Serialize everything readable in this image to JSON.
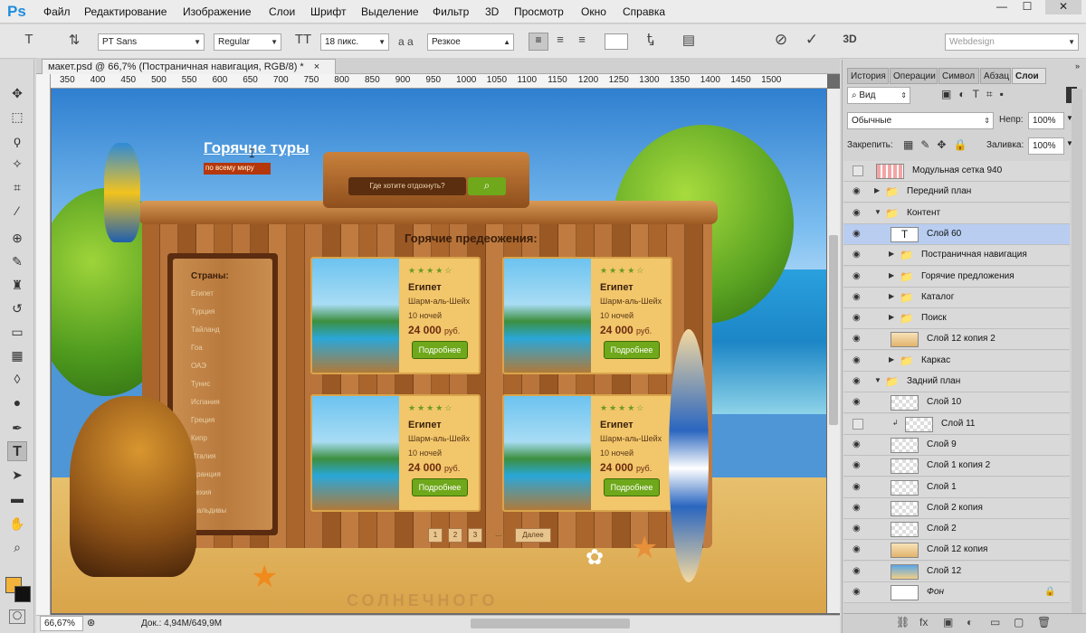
{
  "app": {
    "logo": "Ps"
  },
  "menu": [
    "Файл",
    "Редактирование",
    "Изображение",
    "Слои",
    "Шрифт",
    "Выделение",
    "Фильтр",
    "3D",
    "Просмотр",
    "Окно",
    "Справка"
  ],
  "window_controls": {
    "minimize": "—",
    "maximize": "☐",
    "close": "✕"
  },
  "options": {
    "font_family": "PT Sans",
    "font_style": "Regular",
    "font_size": "18 пикс.",
    "antialias_label": "a a",
    "antialias": "Резкое",
    "workspace": "Webdesign"
  },
  "document": {
    "tab_title": "макет.psd @ 66,7% (Постраничная навигация, RGB/8) *",
    "tab_close": "×",
    "ruler_ticks": [
      "350",
      "400",
      "450",
      "500",
      "550",
      "600",
      "650",
      "700",
      "750",
      "800",
      "850",
      "900",
      "950",
      "1000",
      "1050",
      "1100",
      "1150",
      "1200",
      "1250",
      "1300",
      "1350",
      "1400",
      "1450",
      "1500"
    ]
  },
  "canvas": {
    "headline": "Горячие туры",
    "subtitle": "по всему миру",
    "search_placeholder": "Где хотите отдохнуть?",
    "offers_title": "Горячие предеожения:",
    "countries_title": "Страны:",
    "countries": [
      "Египет",
      "Турция",
      "Тайланд",
      "Гоа",
      "ОАЭ",
      "Тунис",
      "Испания",
      "Греция",
      "Кипр",
      "Италия",
      "Франция",
      "Чехия",
      "Мальдивы"
    ],
    "cards": [
      {
        "stars": "★★★★☆",
        "title": "Египет",
        "place": "Шарм-аль-Шейх",
        "nights": "10 ночей",
        "price": "24 000",
        "currency": "руб.",
        "button": "Подробнее"
      },
      {
        "stars": "★★★★☆",
        "title": "Египет",
        "place": "Шарм-аль-Шейх",
        "nights": "10 ночей",
        "price": "24 000",
        "currency": "руб.",
        "button": "Подробнее"
      },
      {
        "stars": "★★★★☆",
        "title": "Египет",
        "place": "Шарм-аль-Шейх",
        "nights": "10 ночей",
        "price": "24 000",
        "currency": "руб.",
        "button": "Подробнее"
      },
      {
        "stars": "★★★★☆",
        "title": "Египет",
        "place": "Шарм-аль-Шейх",
        "nights": "10 ночей",
        "price": "24 000",
        "currency": "руб.",
        "button": "Подробнее"
      }
    ],
    "pages": [
      "1",
      "2",
      "3"
    ],
    "ellipsis": "...",
    "next": "Далее",
    "sand_text": "СОЛНЕЧНОГО"
  },
  "status": {
    "zoom": "66,67%",
    "doc": "Док.: 4,94M/649,9M"
  },
  "panel": {
    "tabs": [
      "История",
      "Операции",
      "Символ",
      "Абзац",
      "Слои"
    ],
    "filter": "Вид",
    "blend": "Обычные",
    "opacity_label": "Непр:",
    "opacity": "100%",
    "lock_label": "Закрепить:",
    "fill_label": "Заливка:",
    "fill": "100%",
    "layers": [
      {
        "name": "Модульная сетка 940",
        "kind": "grid",
        "vis": false,
        "indent": 0
      },
      {
        "name": "Передний план",
        "kind": "folder",
        "vis": true,
        "indent": 0,
        "open": false
      },
      {
        "name": "Контент",
        "kind": "folder",
        "vis": true,
        "indent": 0,
        "open": true
      },
      {
        "name": "Слой 60",
        "kind": "text",
        "vis": true,
        "indent": 1,
        "active": true
      },
      {
        "name": "Постраничная навигация",
        "kind": "folder",
        "vis": true,
        "indent": 1,
        "open": false
      },
      {
        "name": "Горячие предложения",
        "kind": "folder",
        "vis": true,
        "indent": 1,
        "open": false
      },
      {
        "name": "Каталог",
        "kind": "folder",
        "vis": true,
        "indent": 1,
        "open": false
      },
      {
        "name": "Поиск",
        "kind": "folder",
        "vis": true,
        "indent": 1,
        "open": false
      },
      {
        "name": "Слой 12 копия 2",
        "kind": "sand",
        "vis": true,
        "indent": 1
      },
      {
        "name": "Каркас",
        "kind": "folder",
        "vis": true,
        "indent": 1,
        "open": false
      },
      {
        "name": "Задний план",
        "kind": "folder",
        "vis": true,
        "indent": 0,
        "open": true
      },
      {
        "name": "Слой 10",
        "kind": "trans",
        "vis": true,
        "indent": 1
      },
      {
        "name": "Слой 11",
        "kind": "trans",
        "vis": false,
        "indent": 2
      },
      {
        "name": "Слой 9",
        "kind": "trans",
        "vis": true,
        "indent": 1
      },
      {
        "name": "Слой 1 копия 2",
        "kind": "trans",
        "vis": true,
        "indent": 1
      },
      {
        "name": "Слой 1",
        "kind": "trans",
        "vis": true,
        "indent": 1
      },
      {
        "name": "Слой 2 копия",
        "kind": "trans",
        "vis": true,
        "indent": 1
      },
      {
        "name": "Слой 2",
        "kind": "trans",
        "vis": true,
        "indent": 1
      },
      {
        "name": "Слой 12 копия",
        "kind": "sand",
        "vis": true,
        "indent": 1
      },
      {
        "name": "Слой 12",
        "kind": "sky",
        "vis": true,
        "indent": 1
      },
      {
        "name": "Фон",
        "kind": "white",
        "vis": true,
        "indent": 1
      }
    ],
    "bottom_icons": [
      "link-icon",
      "fx-icon",
      "mask-icon",
      "adjustment-icon",
      "group-icon",
      "new-layer-icon",
      "trash-icon"
    ]
  },
  "colors": {
    "accent": "#1f8de0",
    "active_layer": "#b8cdf0",
    "wood": "#a9652b",
    "button_green": "#6fa81b"
  }
}
